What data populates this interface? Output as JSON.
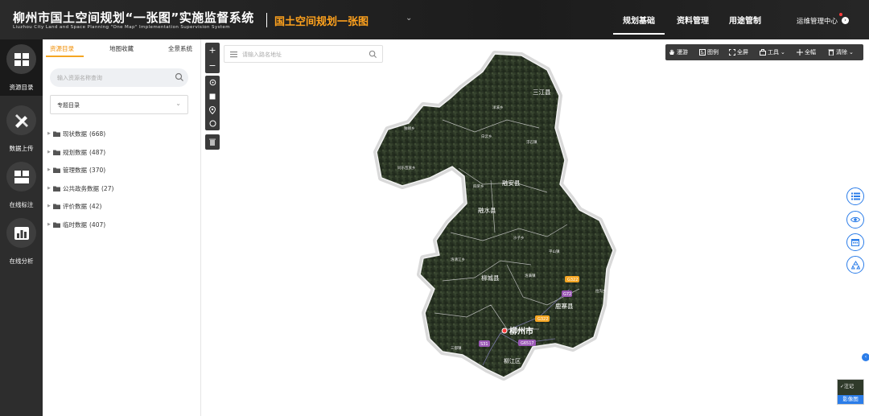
{
  "header": {
    "title_cn": "柳州市国土空间规划“一张图”实施监督系统",
    "title_en": "Liuzhou City Land and Space Planning \"One Map\" Implementation Supervision System",
    "subtitle": "国土空间规划一张图",
    "subtitle_chevron": "⌄",
    "nav": [
      "规划基础",
      "资料管理",
      "用途管制"
    ],
    "ops_center": "运维管理中心",
    "ops_icon": "›"
  },
  "rail": {
    "items": [
      {
        "label": "资源目录",
        "icon": "grid-icon"
      },
      {
        "label": "数据上传",
        "icon": "pencil-ruler-icon"
      },
      {
        "label": "在线标注",
        "icon": "grid-icon"
      },
      {
        "label": "在线分析",
        "icon": "chart-icon"
      }
    ]
  },
  "panel": {
    "tabs": [
      "资源目录",
      "地图收藏",
      "全景系统"
    ],
    "search_placeholder": "输入资源名称查询",
    "select_value": "专题目录",
    "select_chevron": "⌄",
    "tree_caret": "▶",
    "tree": [
      {
        "label": "现状数据",
        "count": "(668)"
      },
      {
        "label": "规划数据",
        "count": "(487)"
      },
      {
        "label": "管理数据",
        "count": "(370)"
      },
      {
        "label": "公共政务数据",
        "count": "(27)"
      },
      {
        "label": "评价数据",
        "count": "(42)"
      },
      {
        "label": "临时数据",
        "count": "(407)"
      }
    ]
  },
  "map_controls": {
    "zoom_in": "+",
    "zoom_out": "−",
    "address_placeholder": "请输入路名地址"
  },
  "toolbar": {
    "items": [
      "漫游",
      "图例",
      "全屏",
      "工具",
      "全幅",
      "清除"
    ]
  },
  "map": {
    "labels": {
      "sanjiang": "三江县",
      "rongan": "融安县",
      "rongshui": "融水县",
      "liucheng": "柳城县",
      "luzhai": "鹿寨县",
      "liuzhou": "柳州市",
      "liujiang": "柳江区",
      "town1": "洋溪乡",
      "town2": "独峒乡",
      "town3": "同乐苗族乡",
      "town4": "白云乡",
      "town5": "四荣乡",
      "town6": "沙子乡",
      "town7": "洛清江乡",
      "town8": "三都镇",
      "town9": "拉沟乡",
      "town10": "洛满镇",
      "town11": "浮石镇",
      "town12": "平山镇"
    },
    "shields": [
      "G322",
      "G72",
      "G322",
      "G6517",
      "S31"
    ]
  },
  "basemap": {
    "check": "✓注记",
    "label": "影像图"
  },
  "collapse": "‹",
  "colors": {
    "accent_orange": "#ffa21d",
    "accent_blue": "#2b7de9",
    "header_bg": "#1c1c1c"
  }
}
